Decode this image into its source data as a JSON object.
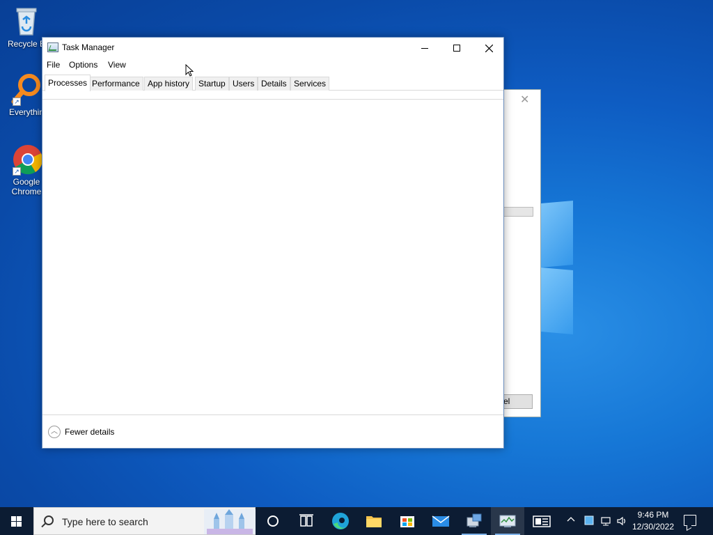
{
  "desktop": {
    "icons": [
      {
        "label": "Recycle B",
        "icon": "recycle-bin-icon"
      },
      {
        "label": "Everythin",
        "icon": "everything-search-icon"
      },
      {
        "label": "Google Chrome",
        "icon": "chrome-icon"
      }
    ]
  },
  "background_dialog": {
    "close_glyph": "✕",
    "button_label": "el"
  },
  "task_manager": {
    "title": "Task Manager",
    "menu": [
      {
        "label": "File"
      },
      {
        "label": "Options"
      },
      {
        "label": "View"
      }
    ],
    "tabs": [
      {
        "label": "Processes",
        "active": true
      },
      {
        "label": "Performance"
      },
      {
        "label": "App history"
      },
      {
        "label": "Startup"
      },
      {
        "label": "Users"
      },
      {
        "label": "Details"
      },
      {
        "label": "Services"
      }
    ],
    "footer": {
      "fewer_details_label": "Fewer details"
    }
  },
  "taskbar": {
    "search_placeholder": "Type here to search",
    "clock": {
      "time": "9:46 PM",
      "date": "12/30/2022"
    },
    "apps": [
      "cortana-icon",
      "task-view-icon",
      "edge-icon",
      "file-explorer-icon",
      "store-icon",
      "mail-icon",
      "remote-desktop-icon",
      "task-manager-icon",
      "news-icon"
    ]
  },
  "colors": {
    "taskbar": "#0c1c33",
    "desktop_blue": "#0e5cc2"
  }
}
